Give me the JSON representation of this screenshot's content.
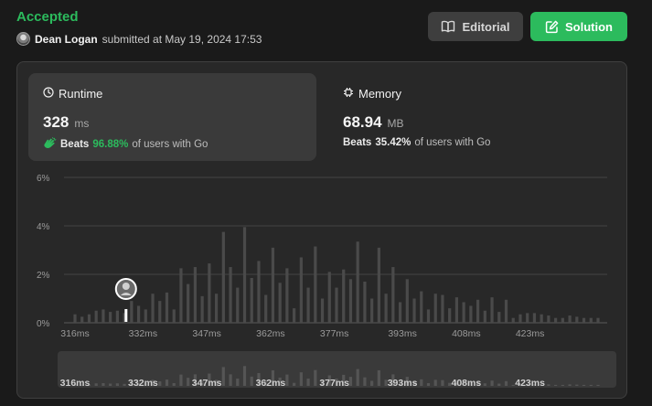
{
  "header": {
    "status": "Accepted",
    "user": "Dean Logan",
    "submitted_text": "submitted at May 19, 2024 17:53",
    "editorial_label": "Editorial",
    "solution_label": "Solution"
  },
  "runtime": {
    "title": "Runtime",
    "value": "328",
    "unit": "ms",
    "beats_word": "Beats",
    "beats_pct": "96.88%",
    "beats_suffix": "of users with Go"
  },
  "memory": {
    "title": "Memory",
    "value": "68.94",
    "unit": "MB",
    "beats_word": "Beats",
    "beats_pct": "35.42%",
    "beats_suffix": "of users with Go"
  },
  "colors": {
    "accent_green": "#2cbb5d",
    "bar": "#4a4a4a",
    "marker": "#ffffff"
  },
  "icons": {
    "editorial": "book-icon",
    "solution": "edit-note-icon",
    "runtime": "clock-icon",
    "memory": "chip-icon",
    "beats": "clap-hands-icon"
  },
  "chart_data": {
    "type": "bar",
    "y_unit": "%",
    "ylim": [
      0,
      6
    ],
    "y_ticks": [
      "6%",
      "4%",
      "2%",
      "0%"
    ],
    "x_ticks": [
      "316ms",
      "332ms",
      "347ms",
      "362ms",
      "377ms",
      "393ms",
      "408ms",
      "423ms"
    ],
    "x_range_ms": [
      316,
      439
    ],
    "highlight_ms": 328,
    "values": [
      0.35,
      0.25,
      0.35,
      0.5,
      0.55,
      0.45,
      0.5,
      0.4,
      0.9,
      0.7,
      0.55,
      1.2,
      0.9,
      1.25,
      0.55,
      2.25,
      1.6,
      2.3,
      1.1,
      2.45,
      1.2,
      3.75,
      2.3,
      1.45,
      3.95,
      1.85,
      2.55,
      1.15,
      3.1,
      1.65,
      2.25,
      0.6,
      2.7,
      1.45,
      3.15,
      1.0,
      2.1,
      1.45,
      2.2,
      1.8,
      3.35,
      1.7,
      1.0,
      3.1,
      1.2,
      2.3,
      0.85,
      1.8,
      1.0,
      1.3,
      0.55,
      1.2,
      1.15,
      0.6,
      1.05,
      0.85,
      0.7,
      0.95,
      0.5,
      1.05,
      0.45,
      0.95,
      0.2,
      0.35,
      0.4,
      0.4,
      0.35,
      0.3,
      0.2,
      0.2,
      0.3,
      0.25,
      0.2,
      0.2,
      0.2
    ],
    "grid": true,
    "legend": "none"
  }
}
